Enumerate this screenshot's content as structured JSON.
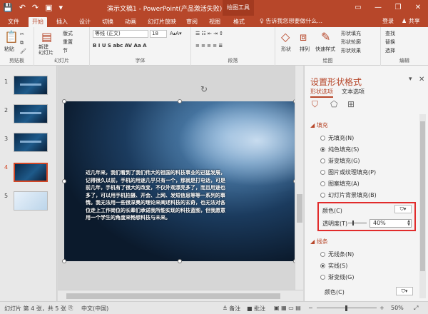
{
  "titlebar": {
    "title": "演示文稿1 - PowerPoint(产品激活失败)",
    "context": "绘图工具",
    "qat": [
      "💾",
      "↶",
      "↷",
      "▣",
      "▾"
    ]
  },
  "window_controls": [
    "▭",
    "—",
    "❐",
    "✕"
  ],
  "tabs": [
    "文件",
    "开始",
    "插入",
    "设计",
    "切换",
    "动画",
    "幻灯片放映",
    "审阅",
    "视图",
    "格式"
  ],
  "active_tab": "开始",
  "tell_me": "♀ 告诉我您想要做什么...",
  "login": "登录",
  "share": "♟ 共享",
  "ribbon": {
    "groups": [
      "剪贴板",
      "幻灯片",
      "字体",
      "段落",
      "绘图",
      "编辑"
    ],
    "paste": "粘贴",
    "new_slide": "新建\n幻灯片",
    "layout": "版式",
    "reset": "重置",
    "section": "节",
    "font_name": "等线 (正文)",
    "font_size": "18",
    "font_buttons": "B  I  U  S  abc  AV  Aa  A",
    "para_buttons": "≡  ≡  ≡  ≡  ≣",
    "shape": "形状",
    "arrange": "排列",
    "quick_style": "快速样式",
    "shape_fill": "形状填充",
    "shape_outline": "形状轮廓",
    "shape_effect": "形状效果",
    "find": "查找",
    "replace": "替换",
    "select": "选择"
  },
  "thumbnails": [
    "1",
    "2",
    "3",
    "4",
    "5"
  ],
  "active_slide": "4",
  "slide_text": "近几年来，我们看到了我们伟大的祖国的科技事业的迅猛发展，记得很久以前，手机的用途几乎只有一个，那就是打电话，可是前几年，手机有了很大的改变，不仅外观漂亮多了，而且用途也多了，可以用手机拍摄、开会、上网、发短信息等等一系列的事情。我无法用一些很深奥的理论来阐述科技的玄奇，也无法对各位走上工作岗位的长辈们承诺我所能实现的科技蓝图，但我愿意用一个学生的角度来畅想科技与未来。",
  "pane": {
    "title": "设置形状格式",
    "tabs": [
      "形状选项",
      "文本选项"
    ],
    "section_fill": "◢ 填充",
    "fill_options": [
      "无填充(N)",
      "纯色填充(S)",
      "渐变填充(G)",
      "图片或纹理填充(P)",
      "图案填充(A)",
      "幻灯片背景填充(B)"
    ],
    "fill_selected": "纯色填充(S)",
    "color_label": "颜色(C)",
    "transparency_label": "透明度(T)",
    "transparency_value": "40%",
    "section_line": "◢ 线条",
    "line_options": [
      "无线条(N)",
      "实线(S)",
      "渐变线(G)"
    ],
    "line_selected": "实线(S)",
    "line_color_label": "颜色(C)"
  },
  "status": {
    "slide_info": "幻灯片 第 4 张，共 5 张",
    "language": "中文(中国)",
    "notes": "≜ 备注",
    "comments": "■ 批注",
    "zoom": "50%"
  },
  "accent_color": "#b7472a"
}
